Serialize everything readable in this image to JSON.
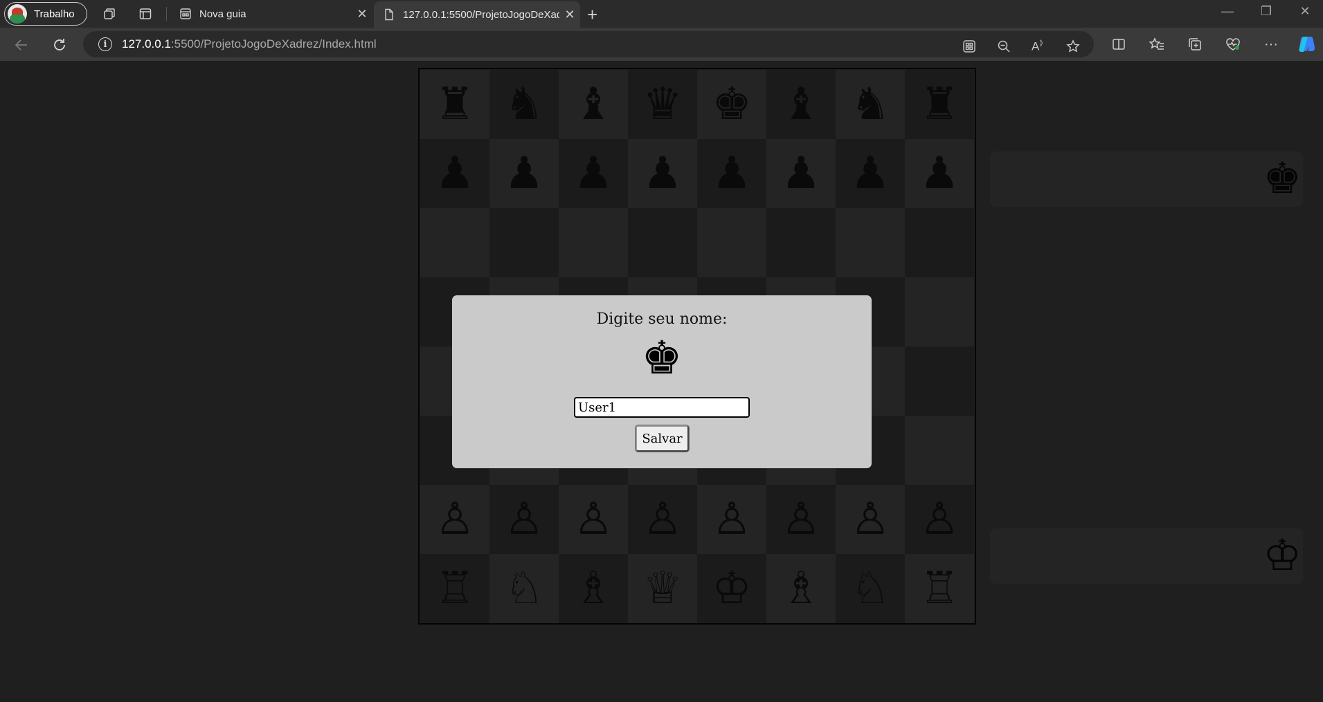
{
  "browser": {
    "profile_label": "Trabalho",
    "tabs": [
      {
        "title": "Nova guia"
      },
      {
        "title": "127.0.0.1:5500/ProjetoJogoDeXadrez"
      }
    ],
    "address": {
      "host": "127.0.0.1",
      "path": ":5500/ProjetoJogoDeXadrez/Index.html"
    }
  },
  "board": {
    "rows": [
      [
        "♜",
        "♞",
        "♝",
        "♛",
        "♚",
        "♝",
        "♞",
        "♜"
      ],
      [
        "♟",
        "♟",
        "♟",
        "♟",
        "♟",
        "♟",
        "♟",
        "♟"
      ],
      [
        "",
        "",
        "",
        "",
        "",
        "",
        "",
        ""
      ],
      [
        "",
        "",
        "",
        "",
        "",
        "",
        "",
        ""
      ],
      [
        "",
        "",
        "",
        "",
        "",
        "",
        "",
        ""
      ],
      [
        "",
        "",
        "",
        "",
        "",
        "",
        "",
        ""
      ],
      [
        "♙",
        "♙",
        "♙",
        "♙",
        "♙",
        "♙",
        "♙",
        "♙"
      ],
      [
        "♖",
        "♘",
        "♗",
        "♕",
        "♔",
        "♗",
        "♘",
        "♖"
      ]
    ]
  },
  "side_panels": {
    "top_icon": "♚",
    "bottom_icon": "♔"
  },
  "modal": {
    "title": "Digite seu nome:",
    "icon": "♚",
    "input_value": "User1",
    "save_label": "Salvar"
  }
}
